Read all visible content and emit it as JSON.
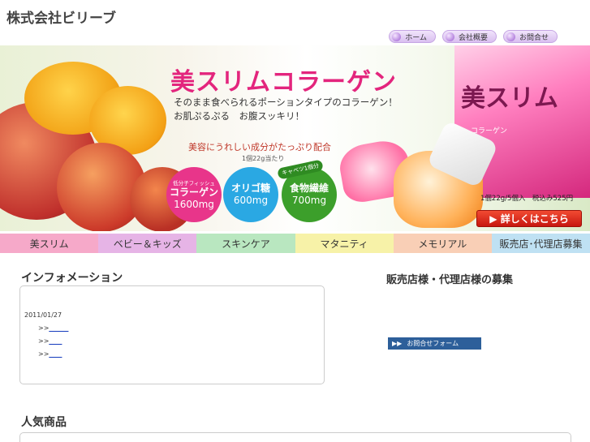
{
  "brand": "株式会社ビリーブ",
  "top_nav": [
    {
      "label": "ホーム"
    },
    {
      "label": "会社概要"
    },
    {
      "label": "お問合せ"
    }
  ],
  "banner": {
    "title": "美スリムコラーゲン",
    "subtitle_line1": "そのまま食べられるポーションタイプのコラーゲン！",
    "subtitle_line2": "お肌ぷるぷる　お腹スッキリ！",
    "subtitle_line3": "美容にうれしい成分がたっぷり配合",
    "serving_note": "1個22g当たり",
    "cabbage_badge": "キャベツ1個分",
    "circles": [
      {
        "small": "低分子フィッシュ",
        "main": "コラーゲン",
        "value": "1600mg",
        "color": "#e8358a"
      },
      {
        "small": "",
        "main": "オリゴ糖",
        "value": "600mg",
        "color": "#2aa8e3"
      },
      {
        "small": "",
        "main": "食物繊維",
        "value": "700mg",
        "color": "#3c9f2b"
      }
    ],
    "product_title": "美スリム",
    "product_sub": "コラーゲン",
    "price": "1個22g/5個入　税込み525円",
    "detail_button": "▶ 詳しくはこちら"
  },
  "category_nav": [
    {
      "label": "美スリム",
      "color": "#f6a9c9"
    },
    {
      "label": "ベビー＆キッズ",
      "color": "#e6b4e6"
    },
    {
      "label": "スキンケア",
      "color": "#b9e7c0"
    },
    {
      "label": "マタニティ",
      "color": "#f7f2a8"
    },
    {
      "label": "メモリアル",
      "color": "#f9cfb6"
    },
    {
      "label": "販売店･代理店募集",
      "color": "#bfe1f3"
    }
  ],
  "info": {
    "heading": "インフォメーション",
    "date": "2011/01/27",
    "links": [
      {
        "prefix": ">>",
        "text": "______"
      },
      {
        "prefix": ">>",
        "text": "____"
      },
      {
        "prefix": ">>",
        "text": "____"
      }
    ]
  },
  "recruit": {
    "heading": "販売店様・代理店様の募集",
    "inquiry_button": "お問合せフォーム",
    "inquiry_icon": "▶▶"
  },
  "popular": {
    "heading": "人気商品"
  }
}
